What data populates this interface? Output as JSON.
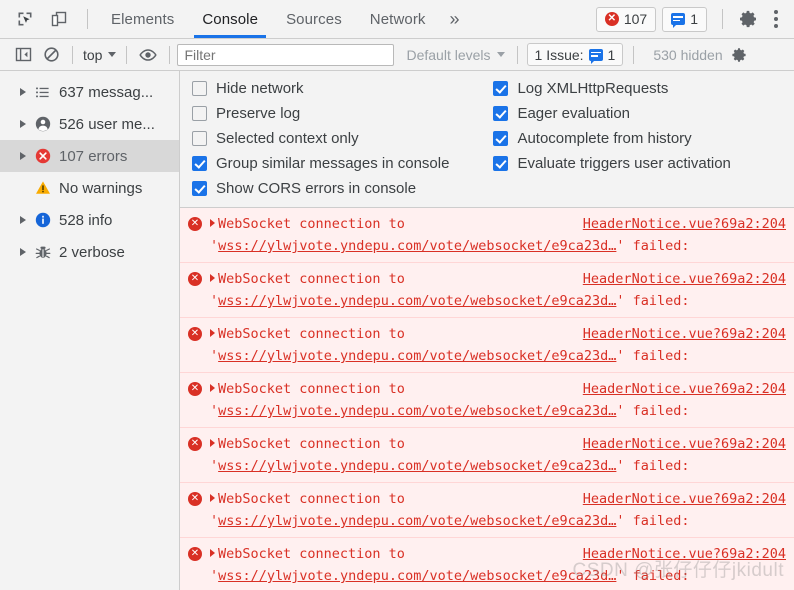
{
  "tabbar": {
    "inspect_icon": "inspect-cursor-icon",
    "device_icon": "device-toolbar-icon",
    "tabs": [
      {
        "label": "Elements",
        "active": false
      },
      {
        "label": "Console",
        "active": true
      },
      {
        "label": "Sources",
        "active": false
      },
      {
        "label": "Network",
        "active": false
      }
    ],
    "more_tabs_label": "»",
    "error_count": "107",
    "message_count": "1",
    "settings_icon": "gear-icon",
    "menu_icon": "kebab-menu-icon"
  },
  "filterbar": {
    "sidebar_toggle_icon": "show-console-sidebar-icon",
    "clear_icon": "clear-console-icon",
    "context_label": "top",
    "eye_icon": "create-live-expression-icon",
    "filter_placeholder": "Filter",
    "filter_value": "",
    "levels_label": "Default levels",
    "issues_label": "1 Issue:",
    "issues_count": "1",
    "hidden_label": "530 hidden",
    "settings_icon": "console-settings-gear-icon"
  },
  "sidebar": {
    "items": [
      {
        "label": "637 messag...",
        "icon": "list-icon",
        "expandable": true,
        "selected": false
      },
      {
        "label": "526 user me...",
        "icon": "user-icon",
        "expandable": true,
        "selected": false
      },
      {
        "label": "107 errors",
        "icon": "error-icon",
        "expandable": true,
        "selected": true
      },
      {
        "label": "No warnings",
        "icon": "warning-icon",
        "expandable": false,
        "selected": false
      },
      {
        "label": "528 info",
        "icon": "info-icon",
        "expandable": true,
        "selected": false
      },
      {
        "label": "2 verbose",
        "icon": "bug-icon",
        "expandable": true,
        "selected": false
      }
    ]
  },
  "settings": {
    "column1": [
      {
        "label": "Hide network",
        "checked": false
      },
      {
        "label": "Preserve log",
        "checked": false
      },
      {
        "label": "Selected context only",
        "checked": false
      },
      {
        "label": "Group similar messages in console",
        "checked": true
      },
      {
        "label": "Show CORS errors in console",
        "checked": true
      }
    ],
    "column2": [
      {
        "label": "Log XMLHttpRequests",
        "checked": true
      },
      {
        "label": "Eager evaluation",
        "checked": true
      },
      {
        "label": "Autocomplete from history",
        "checked": true
      },
      {
        "label": "Evaluate triggers user activation",
        "checked": true
      }
    ]
  },
  "console": {
    "messages": [
      {
        "prefix": "WebSocket connection to '",
        "url": "wss://ylwjvote.yndepu.com/vote/websocket/e9ca23d…",
        "suffix": "' failed:",
        "source": "HeaderNotice.vue?69a2:204"
      },
      {
        "prefix": "WebSocket connection to '",
        "url": "wss://ylwjvote.yndepu.com/vote/websocket/e9ca23d…",
        "suffix": "' failed:",
        "source": "HeaderNotice.vue?69a2:204"
      },
      {
        "prefix": "WebSocket connection to '",
        "url": "wss://ylwjvote.yndepu.com/vote/websocket/e9ca23d…",
        "suffix": "' failed:",
        "source": "HeaderNotice.vue?69a2:204"
      },
      {
        "prefix": "WebSocket connection to '",
        "url": "wss://ylwjvote.yndepu.com/vote/websocket/e9ca23d…",
        "suffix": "' failed:",
        "source": "HeaderNotice.vue?69a2:204"
      },
      {
        "prefix": "WebSocket connection to '",
        "url": "wss://ylwjvote.yndepu.com/vote/websocket/e9ca23d…",
        "suffix": "' failed:",
        "source": "HeaderNotice.vue?69a2:204"
      },
      {
        "prefix": "WebSocket connection to '",
        "url": "wss://ylwjvote.yndepu.com/vote/websocket/e9ca23d…",
        "suffix": "' failed:",
        "source": "HeaderNotice.vue?69a2:204"
      },
      {
        "prefix": "WebSocket connection to '",
        "url": "wss://ylwjvote.yndepu.com/vote/websocket/e9ca23d…",
        "suffix": "' failed:",
        "source": "HeaderNotice.vue?69a2:204"
      }
    ]
  },
  "watermark": {
    "text": "CSDN @张仔仔仔jkidult"
  },
  "colors": {
    "accent": "#1a73e8",
    "error": "#d93025",
    "warning": "#f9ab00",
    "chrome_bg": "#f3f3f3",
    "error_row_bg": "#fff0f0"
  }
}
